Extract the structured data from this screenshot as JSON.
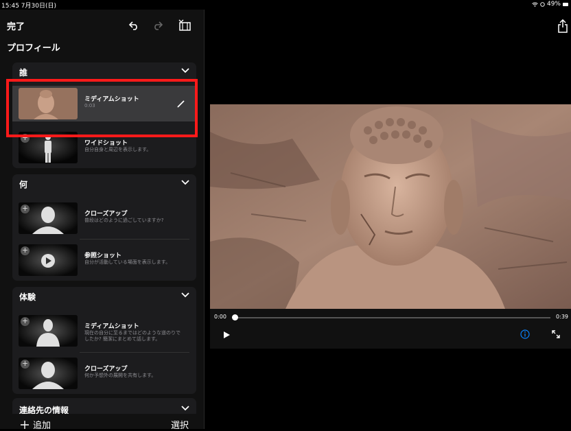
{
  "status": {
    "time": "15:45  7月30日(日)",
    "battery": "49%"
  },
  "toolbar": {
    "done_label": "完了"
  },
  "page": {
    "title": "プロフィール"
  },
  "sections": [
    {
      "title": "誰",
      "items": [
        {
          "title": "ミディアムショット",
          "desc": "0:03"
        },
        {
          "title": "ワイドショット",
          "desc": "自分自身と周辺を表示します。"
        }
      ]
    },
    {
      "title": "何",
      "items": [
        {
          "title": "クローズアップ",
          "desc": "普段はどのように過ごしていますか?"
        },
        {
          "title": "参照ショット",
          "desc": "自分が活動している場面を表示します。"
        }
      ]
    },
    {
      "title": "体験",
      "items": [
        {
          "title": "ミディアムショット",
          "desc": "現在の自分に至るまではどのような道のりでしたか? 簡潔にまとめて話します。"
        },
        {
          "title": "クローズアップ",
          "desc": "何か予想外の展開を共有します。"
        }
      ]
    },
    {
      "title": "連絡先の情報",
      "items": []
    }
  ],
  "bottom": {
    "add_label": "追加",
    "select_label": "選択"
  },
  "player": {
    "current_time": "0:00",
    "end_time": "0:39",
    "progress": 0.0
  },
  "colors": {
    "highlight": "#ff1a1a",
    "accent": "#0a84ff"
  }
}
